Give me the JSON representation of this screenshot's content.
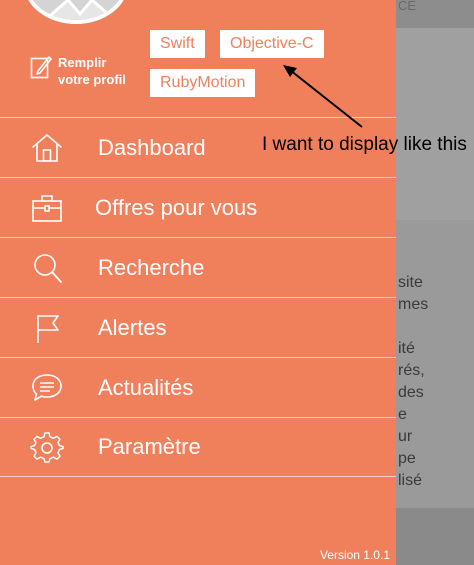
{
  "drawer": {
    "profile_label_line1": "Remplir",
    "profile_label_line2": "votre profil",
    "tags": [
      "Swift",
      "Objective-C",
      "RubyMotion"
    ],
    "menu": [
      {
        "label": "Dashboard",
        "icon": "home-icon"
      },
      {
        "label": "Offres pour vous",
        "icon": "briefcase-icon"
      },
      {
        "label": "Recherche",
        "icon": "search-icon"
      },
      {
        "label": "Alertes",
        "icon": "flag-icon"
      },
      {
        "label": "Actualités",
        "icon": "chat-icon"
      },
      {
        "label": "Paramètre",
        "icon": "gear-icon"
      }
    ],
    "version": "Version 1.0.1"
  },
  "annotation": {
    "text": "I want to display like this"
  },
  "background": {
    "corner_text": "CE",
    "lines": [
      "site",
      "mes",
      "",
      "ité",
      "rés,",
      "des",
      "e",
      "ur",
      "pe",
      "lisé"
    ]
  },
  "colors": {
    "drawer": "#f07f5c",
    "text": "#ffffff",
    "background_overlay": "#9a9a9a"
  }
}
